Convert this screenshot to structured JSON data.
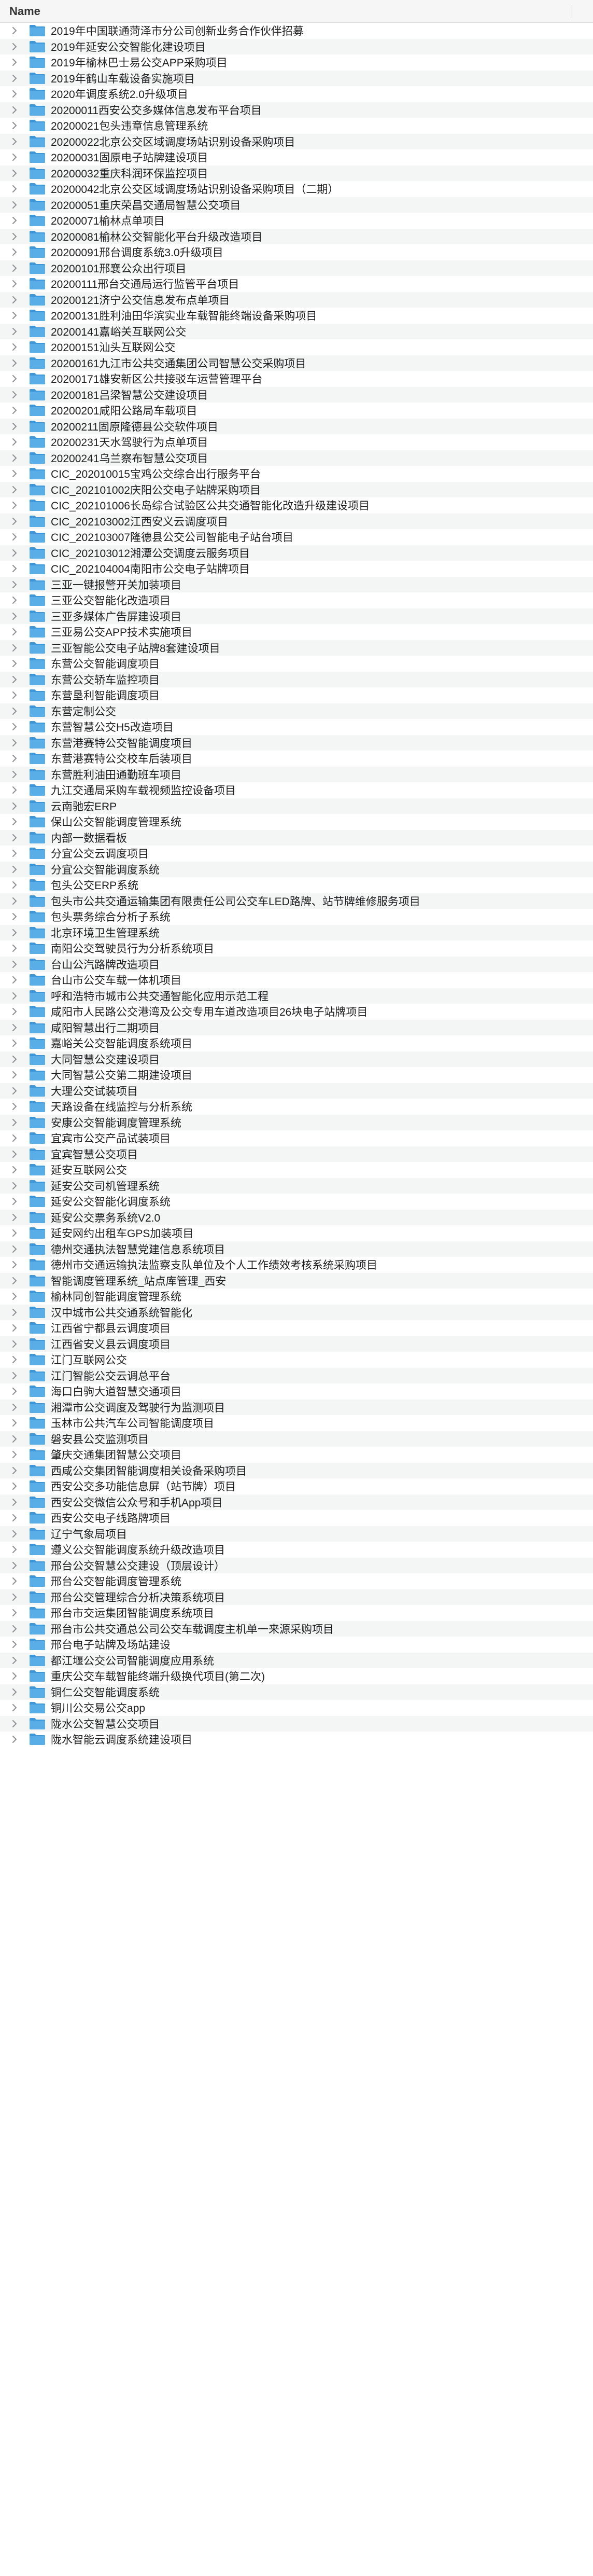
{
  "header": {
    "name_label": "Name"
  },
  "colors": {
    "folder_front": "#5aaee8",
    "folder_back": "#3d97d9",
    "stripe": "#f4f5f5",
    "chevron": "#8e8e93"
  },
  "icons": {
    "row_icon": "folder-icon",
    "disclosure": "chevron-right-icon"
  },
  "folders": [
    "2019年中国联通菏泽市分公司创新业务合作伙伴招募",
    "2019年延安公交智能化建设项目",
    "2019年榆林巴士易公交APP采购项目",
    "2019年鹤山车载设备实施项目",
    "2020年调度系统2.0升级项目",
    "20200011西安公交多媒体信息发布平台项目",
    "20200021包头违章信息管理系统",
    "20200022北京公交区域调度场站识别设备采购项目",
    "20200031固原电子站牌建设项目",
    "20200032重庆科润环保监控项目",
    "20200042北京公交区域调度场站识别设备采购项目（二期）",
    "20200051重庆荣昌交通局智慧公交项目",
    "20200071榆林点单项目",
    "20200081榆林公交智能化平台升级改造项目",
    "20200091邢台调度系统3.0升级项目",
    "20200101邢襄公众出行项目",
    "20200111邢台交通局运行监管平台项目",
    "20200121济宁公交信息发布点单项目",
    "20200131胜利油田华滨实业车载智能终端设备采购项目",
    "20200141嘉峪关互联网公交",
    "20200151汕头互联网公交",
    "20200161九江市公共交通集团公司智慧公交采购项目",
    "20200171雄安新区公共接驳车运营管理平台",
    "20200181吕梁智慧公交建设项目",
    "20200201咸阳公路局车载项目",
    "20200211固原隆德县公交软件项目",
    "20200231天水驾驶行为点单项目",
    "20200241乌兰察布智慧公交项目",
    "CIC_202010015宝鸡公交综合出行服务平台",
    "CIC_202101002庆阳公交电子站牌采购项目",
    "CIC_202101006长岛综合试验区公共交通智能化改造升级建设项目",
    "CIC_202103002江西安义云调度项目",
    "CIC_202103007隆德县公交公司智能电子站台项目",
    "CIC_202103012湘潭公交调度云服务项目",
    "CIC_202104004南阳市公交电子站牌项目",
    "三亚一键报警开关加装项目",
    "三亚公交智能化改造项目",
    "三亚多媒体广告屏建设项目",
    "三亚易公交APP技术实施项目",
    "三亚智能公交电子站牌8套建设项目",
    "东营公交智能调度项目",
    "东营公交轿车监控项目",
    "东营垦利智能调度项目",
    "东营定制公交",
    "东营智慧公交H5改造项目",
    "东营港赛特公交智能调度项目",
    "东营港赛特公交校车后装项目",
    "东营胜利油田通勤班车项目",
    "九江交通局采购车载视频监控设备项目",
    "云南驰宏ERP",
    "保山公交智能调度管理系统",
    "内部一数据看板",
    "分宜公交云调度项目",
    "分宜公交智能调度系统",
    "包头公交ERP系统",
    "包头市公共交通运输集团有限责任公司公交车LED路牌、站节牌维修服务项目",
    "包头票务综合分析子系统",
    "北京环境卫生管理系统",
    "南阳公交驾驶员行为分析系统项目",
    "台山公汽路牌改造项目",
    "台山市公交车载一体机项目",
    "呼和浩特市城市公共交通智能化应用示范工程",
    "咸阳市人民路公交港湾及公交专用车道改造项目26块电子站牌项目",
    "咸阳智慧出行二期项目",
    "嘉峪关公交智能调度系统项目",
    "大同智慧公交建设项目",
    "大同智慧公交第二期建设项目",
    "大理公交试装项目",
    "天路设备在线监控与分析系统",
    "安康公交智能调度管理系统",
    "宜宾市公交产品试装项目",
    "宜宾智慧公交项目",
    "延安互联网公交",
    "延安公交司机管理系统",
    "延安公交智能化调度系统",
    "延安公交票务系统V2.0",
    "延安网约出租车GPS加装项目",
    "德州交通执法智慧党建信息系统项目",
    "德州市交通运输执法监察支队单位及个人工作绩效考核系统采购项目",
    "智能调度管理系统_站点库管理_西安",
    "榆林同创智能调度管理系统",
    "汉中城市公共交通系统智能化",
    "江西省宁都县云调度项目",
    "江西省安义县云调度项目",
    "江门互联网公交",
    "江门智能公交云调总平台",
    "海口白驹大道智慧交通项目",
    "湘潭市公交调度及驾驶行为监测项目",
    "玉林市公共汽车公司智能调度项目",
    "磐安县公交监测项目",
    "肇庆交通集团智慧公交项目",
    "西咸公交集团智能调度相关设备采购项目",
    "西安公交多功能信息屏（站节牌）项目",
    "西安公交微信公众号和手机App项目",
    "西安公交电子线路牌项目",
    "辽宁气象局项目",
    "遵义公交智能调度系统升级改造项目",
    "邢台公交智慧公交建设（顶层设计）",
    "邢台公交智能调度管理系统",
    "邢台公交管理综合分析决策系统项目",
    "邢台市交运集团智能调度系统项目",
    "邢台市公共交通总公司公交车载调度主机单一来源采购项目",
    "邢台电子站牌及场站建设",
    "都江堰公交公司智能调度应用系统",
    "重庆公交车载智能终端升级换代项目(第二次)",
    "铜仁公交智能调度系统",
    "铜川公交易公交app",
    "陇水公交智慧公交项目",
    "陇水智能云调度系统建设项目"
  ]
}
